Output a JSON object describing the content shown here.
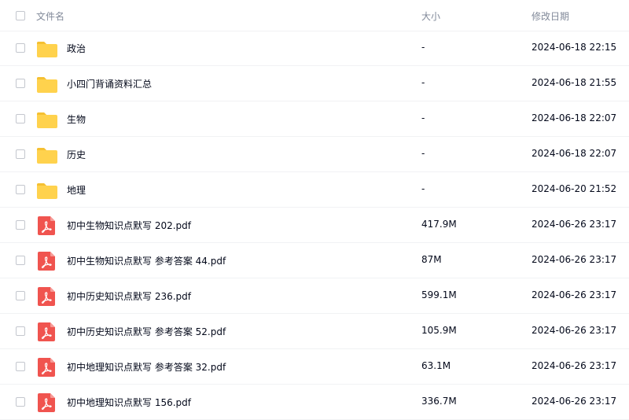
{
  "header": {
    "name_label": "文件名",
    "size_label": "大小",
    "date_label": "修改日期"
  },
  "files": [
    {
      "name": "政治",
      "size": "-",
      "date": "2024-06-18 22:15",
      "type": "folder",
      "icon": "folder-icon"
    },
    {
      "name": "小四门背诵资料汇总",
      "size": "-",
      "date": "2024-06-18 21:55",
      "type": "folder",
      "icon": "folder-icon"
    },
    {
      "name": "生物",
      "size": "-",
      "date": "2024-06-18 22:07",
      "type": "folder",
      "icon": "folder-icon"
    },
    {
      "name": "历史",
      "size": "-",
      "date": "2024-06-18 22:07",
      "type": "folder",
      "icon": "folder-icon"
    },
    {
      "name": "地理",
      "size": "-",
      "date": "2024-06-20 21:52",
      "type": "folder",
      "icon": "folder-icon"
    },
    {
      "name": "初中生物知识点默写 202.pdf",
      "size": "417.9M",
      "date": "2024-06-26 23:17",
      "type": "pdf",
      "icon": "pdf-icon"
    },
    {
      "name": "初中生物知识点默写 参考答案 44.pdf",
      "size": "87M",
      "date": "2024-06-26 23:17",
      "type": "pdf",
      "icon": "pdf-icon"
    },
    {
      "name": "初中历史知识点默写 236.pdf",
      "size": "599.1M",
      "date": "2024-06-26 23:17",
      "type": "pdf",
      "icon": "pdf-icon"
    },
    {
      "name": "初中历史知识点默写 参考答案 52.pdf",
      "size": "105.9M",
      "date": "2024-06-26 23:17",
      "type": "pdf",
      "icon": "pdf-icon"
    },
    {
      "name": "初中地理知识点默写 参考答案 32.pdf",
      "size": "63.1M",
      "date": "2024-06-26 23:17",
      "type": "pdf",
      "icon": "pdf-icon"
    },
    {
      "name": "初中地理知识点默写 156.pdf",
      "size": "336.7M",
      "date": "2024-06-26 23:17",
      "type": "pdf",
      "icon": "pdf-icon"
    }
  ],
  "colors": {
    "folder": "#ffd24d",
    "folder_tab": "#f5c032",
    "pdf": "#f0544f",
    "header_text": "#818999",
    "text": "#03081a",
    "divider": "#f1f2f4"
  }
}
